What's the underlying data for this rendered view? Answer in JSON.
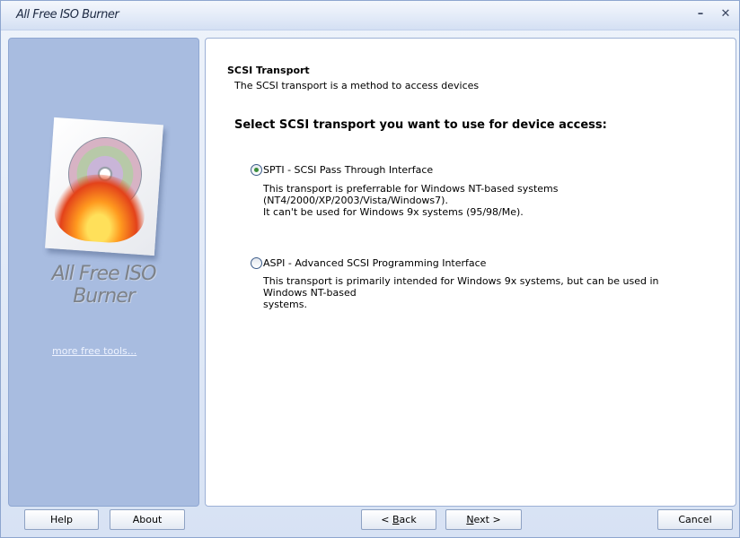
{
  "window": {
    "title": "All Free ISO Burner",
    "minimize_glyph": "–",
    "close_glyph": "✕"
  },
  "sidebar": {
    "logo_icon": "burning-disc-logo",
    "brand_line1": "All Free ISO",
    "brand_line2": "Burner",
    "more_tools_link": "more free tools..."
  },
  "content": {
    "section_title": "SCSI Transport",
    "section_subtitle": "The SCSI transport is a method to access devices",
    "question": "Select SCSI transport you want to use for device access:",
    "options": [
      {
        "label": "SPTI - SCSI Pass Through Interface",
        "selected": true,
        "desc_line1": "This transport is preferrable for Windows NT-based systems (NT4/2000/XP/2003/Vista/Windows7).",
        "desc_line2": "It can't be used for Windows 9x systems (95/98/Me)."
      },
      {
        "label": "ASPI - Advanced SCSI Programming Interface",
        "selected": false,
        "desc_line1": "This transport is primarily intended for Windows 9x systems, but can be used in Windows NT-based",
        "desc_line2": "systems."
      }
    ]
  },
  "footer": {
    "help_label": "Help",
    "about_label": "About",
    "back_prefix": "< ",
    "back_accel": "B",
    "back_rest": "ack",
    "next_accel": "N",
    "next_rest": "ext >",
    "cancel_label": "Cancel"
  }
}
